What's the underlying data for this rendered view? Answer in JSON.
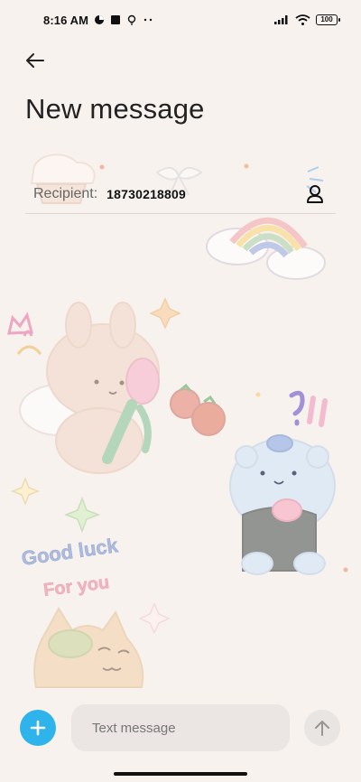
{
  "status_bar": {
    "time": "8:16 AM",
    "battery": "100",
    "icons": [
      "status-circle-icon",
      "status-square-icon",
      "status-bulb-icon",
      "status-dots-icon",
      "cellular-signal-icon",
      "wifi-icon",
      "battery-icon"
    ]
  },
  "header": {
    "back_icon": "back-arrow-icon",
    "title": "New message"
  },
  "recipient": {
    "label": "Recipient:",
    "value": "18730218809",
    "contact_icon": "contact-person-icon"
  },
  "wallpaper": {
    "text_1": "Good luck",
    "text_2": "For you"
  },
  "composer": {
    "placeholder": "Text message",
    "add_icon": "plus-icon",
    "send_icon": "send-arrow-icon",
    "accent_color": "#2eb4ea"
  }
}
